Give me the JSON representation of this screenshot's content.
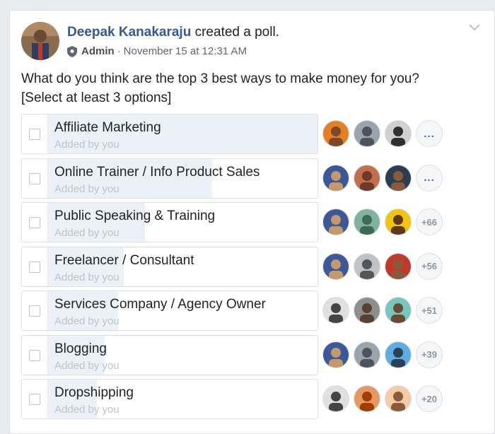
{
  "post": {
    "author": "Deepak Kanakaraju",
    "action": "created a poll.",
    "role": "Admin",
    "separator": "·",
    "timestamp": "November 15 at 12:31 AM",
    "question_line1": "What do you think are the top 3 best ways to make money for you?",
    "question_line2": "[Select at least 3 options]"
  },
  "options": [
    {
      "label": "Affiliate Marketing",
      "sub": "Added by you",
      "vote_share": 1.0,
      "more": "...",
      "voters": [
        "orange-face",
        "street-photo",
        "bw-photo"
      ]
    },
    {
      "label": "Online Trainer / Info Product Sales",
      "sub": "Added by you",
      "vote_share": 0.61,
      "more": "...",
      "voters": [
        "speaker-mic",
        "brick-wall",
        "dark-face"
      ]
    },
    {
      "label": "Public Speaking & Training",
      "sub": "Added by you",
      "vote_share": 0.36,
      "more": "+66",
      "voters": [
        "speaker-mic",
        "outdoor-tree",
        "yellow-face"
      ]
    },
    {
      "label": "Freelancer / Consultant",
      "sub": "Added by you",
      "vote_share": 0.28,
      "more": "+56",
      "voters": [
        "speaker-mic",
        "grey-face",
        "red-cap"
      ]
    },
    {
      "label": "Services Company / Agency Owner",
      "sub": "Added by you",
      "vote_share": 0.26,
      "more": "+51",
      "voters": [
        "bw-face",
        "wall-face",
        "teal-face"
      ]
    },
    {
      "label": "Blogging",
      "sub": "Added by you",
      "vote_share": 0.21,
      "more": "+39",
      "voters": [
        "speaker-mic",
        "street-photo",
        "sky-photo"
      ]
    },
    {
      "label": "Dropshipping",
      "sub": "Added by you",
      "vote_share": 0.18,
      "more": "+20",
      "voters": [
        "bw-face",
        "group-photo",
        "beige-face"
      ]
    }
  ],
  "colors": {
    "link": "#365899",
    "fill": "#ecf0f7",
    "border": "#dddfe2",
    "muted": "#90949c"
  }
}
